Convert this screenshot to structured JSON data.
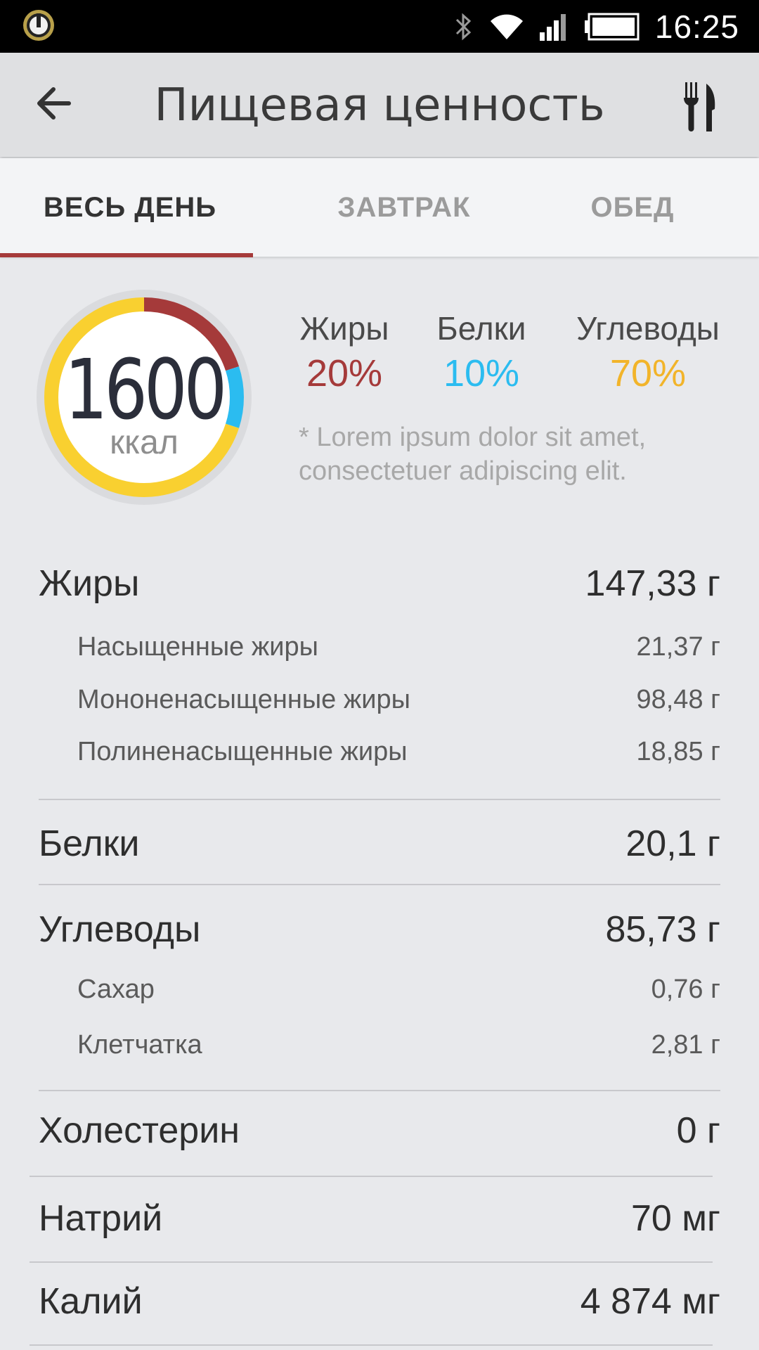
{
  "status_bar": {
    "time": "16:25"
  },
  "app_bar": {
    "title": "Пищевая ценность"
  },
  "tabs": [
    {
      "label": "ВЕСЬ ДЕНЬ"
    },
    {
      "label": "ЗАВТРАК"
    },
    {
      "label": "ОБЕД"
    }
  ],
  "summary": {
    "kcal_value": "1600",
    "kcal_unit": "ккал",
    "macros": [
      {
        "label": "Жиры",
        "percent": "20%",
        "color": "#a53a3a"
      },
      {
        "label": "Белки",
        "percent": "10%",
        "color": "#2bbcf0"
      },
      {
        "label": "Углеводы",
        "percent": "70%",
        "color": "#f2b42a"
      }
    ],
    "note": "* Lorem ipsum dolor sit amet, consectetuer adipiscing elit.",
    "ring_colors": {
      "fat": "#a53a3a",
      "protein": "#2bbcf0",
      "carbs": "#f9d030"
    }
  },
  "nutrients": {
    "fats": {
      "name": "Жиры",
      "value": "147,33 г"
    },
    "saturated": {
      "name": "Насыщенные жиры",
      "value": "21,37 г"
    },
    "mono": {
      "name": "Мононенасыщенные жиры",
      "value": "98,48 г"
    },
    "poly": {
      "name": "Полиненасыщенные жиры",
      "value": "18,85 г"
    },
    "proteins": {
      "name": "Белки",
      "value": "20,1 г"
    },
    "carbs": {
      "name": "Углеводы",
      "value": "85,73 г"
    },
    "sugar": {
      "name": "Сахар",
      "value": "0,76 г"
    },
    "fiber": {
      "name": "Клетчатка",
      "value": "2,81 г"
    },
    "cholesterol": {
      "name": "Холестерин",
      "value": "0 г"
    },
    "sodium": {
      "name": "Натрий",
      "value": "70 мг"
    },
    "potassium": {
      "name": "Калий",
      "value": "4 874 мг"
    }
  }
}
